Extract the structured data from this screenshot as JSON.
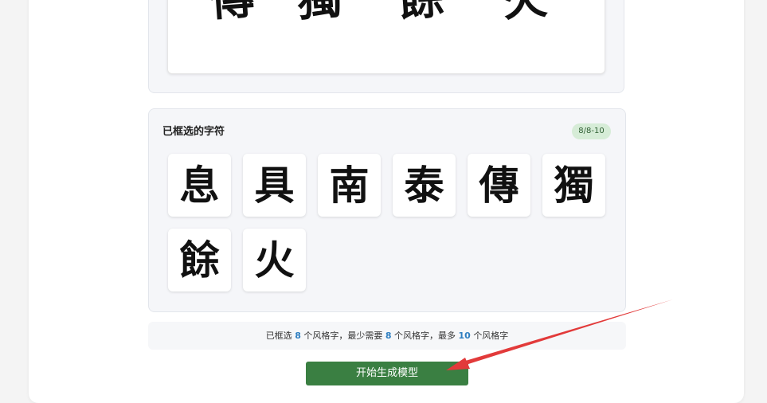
{
  "preview": {
    "characters": [
      "傳",
      "獨",
      "餘",
      "火"
    ]
  },
  "selected_panel": {
    "title": "已框选的字符",
    "badge": "8/8-10",
    "characters": [
      "息",
      "具",
      "南",
      "泰",
      "傳",
      "獨",
      "餘",
      "火"
    ]
  },
  "info": {
    "prefix": "已框选",
    "selected_count": "8",
    "mid1": "个风格字，最少需要",
    "min_count": "8",
    "mid2": "个风格字，最多",
    "max_count": "10",
    "suffix": "个风格字"
  },
  "actions": {
    "generate_label": "开始生成模型"
  },
  "colors": {
    "button": "#3a7f42",
    "badge_bg": "#d6ecd7",
    "count_accent": "#2f7fc1",
    "annotation_arrow": "#e23a3a"
  }
}
